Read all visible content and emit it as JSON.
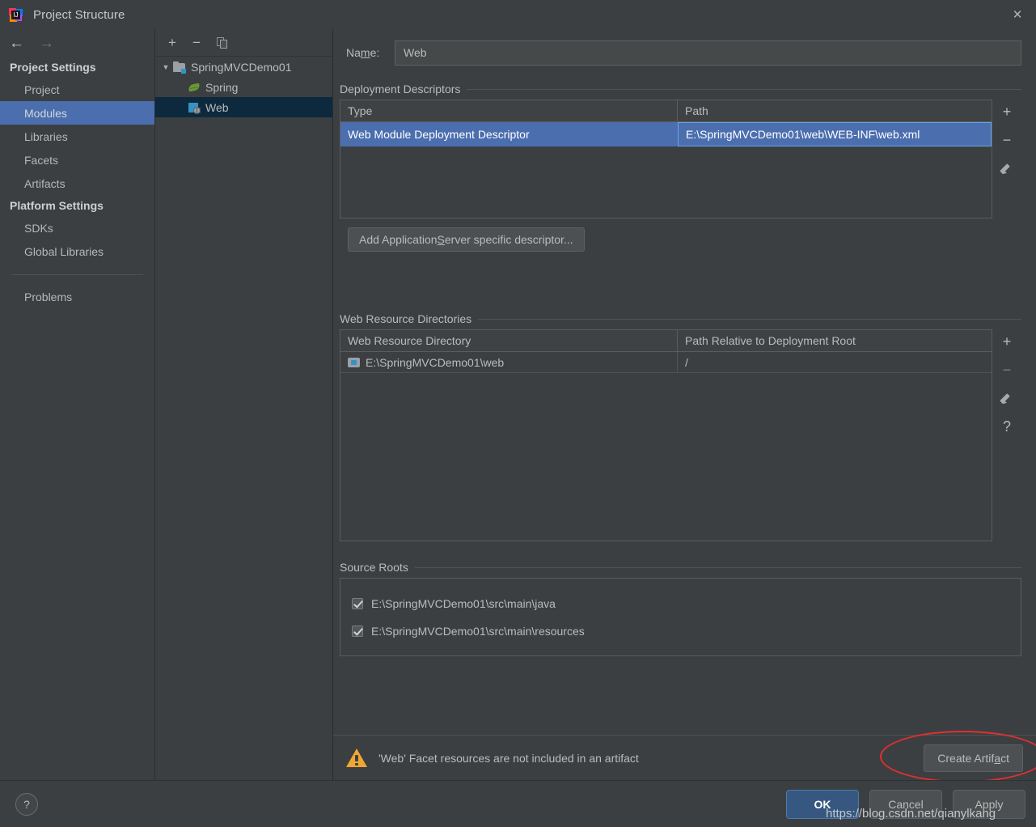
{
  "window": {
    "title": "Project Structure",
    "app_icon": "intellij-idea-icon",
    "close_label": "×"
  },
  "nav": {
    "back_icon": "←",
    "forward_icon": "→"
  },
  "sidebar": {
    "groups": [
      {
        "header": "Project Settings",
        "items": [
          {
            "label": "Project",
            "selected": false
          },
          {
            "label": "Modules",
            "selected": true
          },
          {
            "label": "Libraries",
            "selected": false
          },
          {
            "label": "Facets",
            "selected": false
          },
          {
            "label": "Artifacts",
            "selected": false
          }
        ]
      },
      {
        "header": "Platform Settings",
        "items": [
          {
            "label": "SDKs",
            "selected": false
          },
          {
            "label": "Global Libraries",
            "selected": false
          }
        ]
      }
    ],
    "problems_label": "Problems"
  },
  "tree": {
    "toolbar": {
      "add": "+",
      "remove": "−",
      "copy_icon": "copy-icon"
    },
    "nodes": [
      {
        "label": "SpringMVCDemo01",
        "icon": "module-folder-icon",
        "expanded": true,
        "level": 0,
        "selected": false
      },
      {
        "label": "Spring",
        "icon": "spring-leaf-icon",
        "level": 1,
        "selected": false
      },
      {
        "label": "Web",
        "icon": "web-facet-icon",
        "level": 1,
        "selected": true
      }
    ]
  },
  "main": {
    "name_field": {
      "label_pre": "Na",
      "label_mnemonic": "m",
      "label_post": "e:",
      "value": "Web",
      "placeholder": ""
    },
    "deployment_descriptors": {
      "title": "Deployment Descriptors",
      "columns": [
        "Type",
        "Path"
      ],
      "rows": [
        {
          "type": "Web Module Deployment Descriptor",
          "path": "E:\\SpringMVCDemo01\\web\\WEB-INF\\web.xml",
          "selected": true
        }
      ],
      "tools": [
        "+",
        "−",
        "pencil-icon"
      ],
      "add_button": {
        "pre": "Add Application ",
        "mnemonic": "S",
        "post": "erver specific descriptor..."
      }
    },
    "web_resource_directories": {
      "title": "Web Resource Directories",
      "columns": [
        "Web Resource Directory",
        "Path Relative to Deployment Root"
      ],
      "rows": [
        {
          "directory": "E:\\SpringMVCDemo01\\web",
          "relative_path": "/",
          "icon": "web-directory-icon"
        }
      ],
      "tools": [
        "+",
        "−",
        "pencil-icon",
        "?"
      ]
    },
    "source_roots": {
      "title": "Source Roots",
      "items": [
        {
          "path": "E:\\SpringMVCDemo01\\src\\main\\java",
          "checked": true
        },
        {
          "path": "E:\\SpringMVCDemo01\\src\\main\\resources",
          "checked": true
        }
      ]
    },
    "warning": {
      "icon": "warning-triangle-icon",
      "text": "'Web' Facet resources are not included in an artifact",
      "action": {
        "pre": "Create Artif",
        "mnemonic": "a",
        "post": "ct"
      }
    }
  },
  "footer": {
    "help_label": "?",
    "ok_label": "OK",
    "cancel_label": "Cancel",
    "apply_label": "Apply"
  },
  "watermark": "https://blog.csdn.net/qianylkang",
  "colors": {
    "background": "#3c3f41",
    "sidebar_selected": "#4b6eaf",
    "tree_selected": "#0d293e",
    "row_selected": "#4b6eaf",
    "primary_button": "#365880",
    "warning": "#f0a732",
    "annotation_ellipse": "#e03030"
  }
}
